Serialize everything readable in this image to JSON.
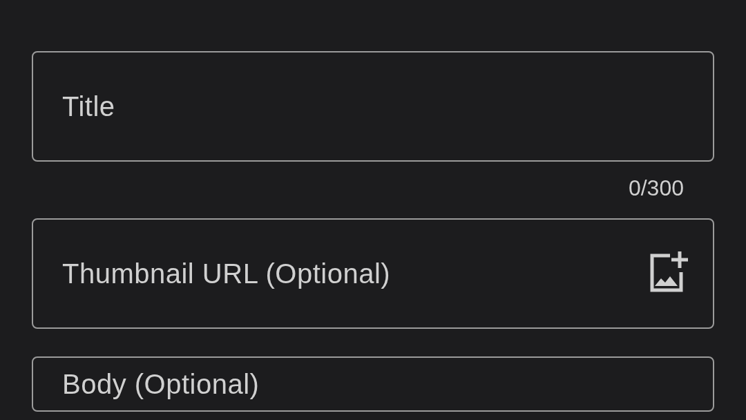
{
  "fields": [
    {
      "kind": "text",
      "placeholder": "Title",
      "counter": "0/300"
    },
    {
      "kind": "image",
      "placeholder": "Thumbnail URL (Optional)"
    },
    {
      "kind": "body",
      "placeholder": "Body (Optional)"
    }
  ]
}
